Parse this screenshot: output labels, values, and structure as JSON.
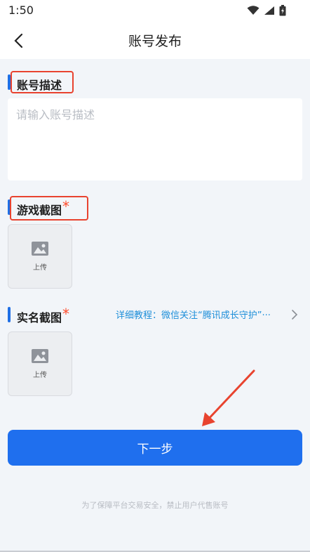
{
  "status_bar": {
    "time": "1:50"
  },
  "nav": {
    "title": "账号发布"
  },
  "description": {
    "label": "账号描述",
    "placeholder": "请输入账号描述"
  },
  "game_screenshot": {
    "label": "游戏截图",
    "required_mark": "*",
    "upload_label": "上传"
  },
  "realname_screenshot": {
    "label": "实名截图",
    "required_mark": "*",
    "upload_label": "上传",
    "tutorial_link": "详细教程：微信关注“腾讯成长守护”···"
  },
  "next_button": {
    "label": "下一步"
  },
  "footer": {
    "note": "为了保障平台交易安全，禁止用户代售账号"
  },
  "colors": {
    "accent": "#1f6fee",
    "link": "#1f8fd9",
    "required": "#ff4b2b",
    "highlight": "#e8432f"
  }
}
